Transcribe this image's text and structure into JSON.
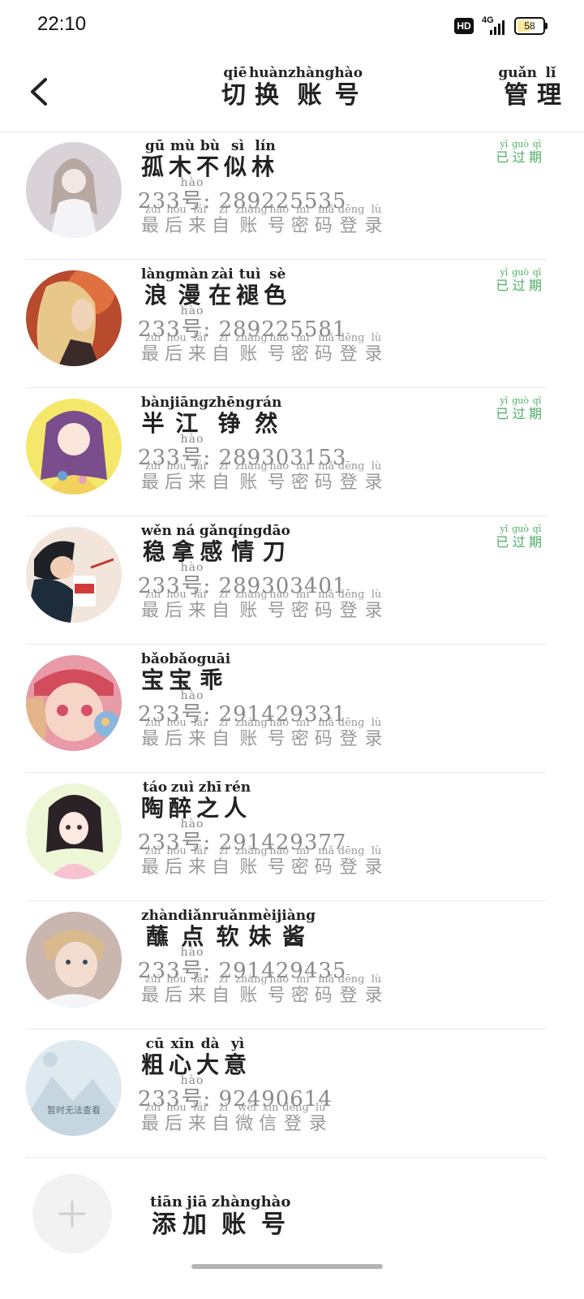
{
  "status_bar": {
    "time": "22:10",
    "hd_label": "HD",
    "network_label": "4G",
    "battery_percent": "58"
  },
  "header": {
    "title": {
      "text": "切换账号",
      "pinyin": [
        "qiē",
        "huàn",
        "zhàng",
        "hào"
      ]
    },
    "manage": {
      "text": "管理",
      "pinyin": [
        "guǎn",
        "lǐ"
      ]
    }
  },
  "expired_label": {
    "text": "已过期",
    "pinyin": [
      "yǐ",
      "guò",
      "qī"
    ]
  },
  "id_prefix": {
    "text": "233号",
    "pinyin": [
      "",
      "",
      "",
      "hào"
    ]
  },
  "accounts": [
    {
      "name": "孤木不似林",
      "name_pinyin": [
        "gū",
        "mù",
        "bù",
        "sì",
        "lín"
      ],
      "id": "289225535",
      "login_text": "最后来自账号密码登录",
      "login_pinyin": [
        "zuì",
        "hòu",
        "lái",
        "zì",
        "zhàng",
        "hào",
        "mì",
        "mǎ",
        "dēng",
        "lù"
      ],
      "expired": true
    },
    {
      "name": "浪漫在褪色",
      "name_pinyin": [
        "làng",
        "màn",
        "zài",
        "tuì",
        "sè"
      ],
      "id": "289225581",
      "login_text": "最后来自账号密码登录",
      "login_pinyin": [
        "zuì",
        "hòu",
        "lái",
        "zì",
        "zhàng",
        "hào",
        "mì",
        "mǎ",
        "dēng",
        "lù"
      ],
      "expired": true
    },
    {
      "name": "半江铮然",
      "name_pinyin": [
        "bàn",
        "jiāng",
        "zhēng",
        "rán"
      ],
      "id": "289303153",
      "login_text": "最后来自账号密码登录",
      "login_pinyin": [
        "zuì",
        "hòu",
        "lái",
        "zì",
        "zhàng",
        "hào",
        "mì",
        "mǎ",
        "dēng",
        "lù"
      ],
      "expired": true
    },
    {
      "name": "稳拿感情刀",
      "name_pinyin": [
        "wěn",
        "ná",
        "gǎn",
        "qíng",
        "dāo"
      ],
      "id": "289303401",
      "login_text": "最后来自账号密码登录",
      "login_pinyin": [
        "zuì",
        "hòu",
        "lái",
        "zì",
        "zhàng",
        "hào",
        "mì",
        "mǎ",
        "dēng",
        "lù"
      ],
      "expired": true
    },
    {
      "name": "宝宝乖",
      "name_pinyin": [
        "bǎo",
        "bǎo",
        "guāi"
      ],
      "id": "291429331",
      "login_text": "最后来自账号密码登录",
      "login_pinyin": [
        "zuì",
        "hòu",
        "lái",
        "zì",
        "zhàng",
        "hào",
        "mì",
        "mǎ",
        "dēng",
        "lù"
      ],
      "expired": false
    },
    {
      "name": "陶醉之人",
      "name_pinyin": [
        "táo",
        "zuì",
        "zhī",
        "rén"
      ],
      "id": "291429377",
      "login_text": "最后来自账号密码登录",
      "login_pinyin": [
        "zuì",
        "hòu",
        "lái",
        "zì",
        "zhàng",
        "hào",
        "mì",
        "mǎ",
        "dēng",
        "lù"
      ],
      "expired": false
    },
    {
      "name": "蘸点软妹酱",
      "name_pinyin": [
        "zhàn",
        "diǎn",
        "ruǎn",
        "mèi",
        "jiàng"
      ],
      "id": "291429435",
      "login_text": "最后来自账号密码登录",
      "login_pinyin": [
        "zuì",
        "hòu",
        "lái",
        "zì",
        "zhàng",
        "hào",
        "mì",
        "mǎ",
        "dēng",
        "lù"
      ],
      "expired": false
    },
    {
      "name": "粗心大意",
      "name_pinyin": [
        "cū",
        "xīn",
        "dà",
        "yì"
      ],
      "id": "92490614",
      "login_text": "最后来自微信登录",
      "login_pinyin": [
        "zuì",
        "hòu",
        "lái",
        "zì",
        "wēi",
        "xìn",
        "dēng",
        "lù"
      ],
      "expired": false,
      "avatar_placeholder": "暂时无法查看"
    }
  ],
  "avatar_icons": [
    "avatar-girl-white-dress-icon",
    "avatar-blonde-braid-icon",
    "avatar-purple-hair-girl-icon",
    "avatar-couple-noodles-icon",
    "avatar-pink-hat-girl-icon",
    "avatar-dark-hair-girl-icon",
    "avatar-sandy-hair-boy-icon",
    "avatar-placeholder-mountain-icon"
  ],
  "add_account": {
    "text": "添加账号",
    "pinyin": [
      "tiān",
      "jiā",
      "zhàng",
      "hào"
    ]
  },
  "colors": {
    "expired_green": "#4caf65",
    "divider": "#eaeaea",
    "muted_text": "#8a8a8a",
    "add_circle_bg": "#f2f2f2"
  }
}
